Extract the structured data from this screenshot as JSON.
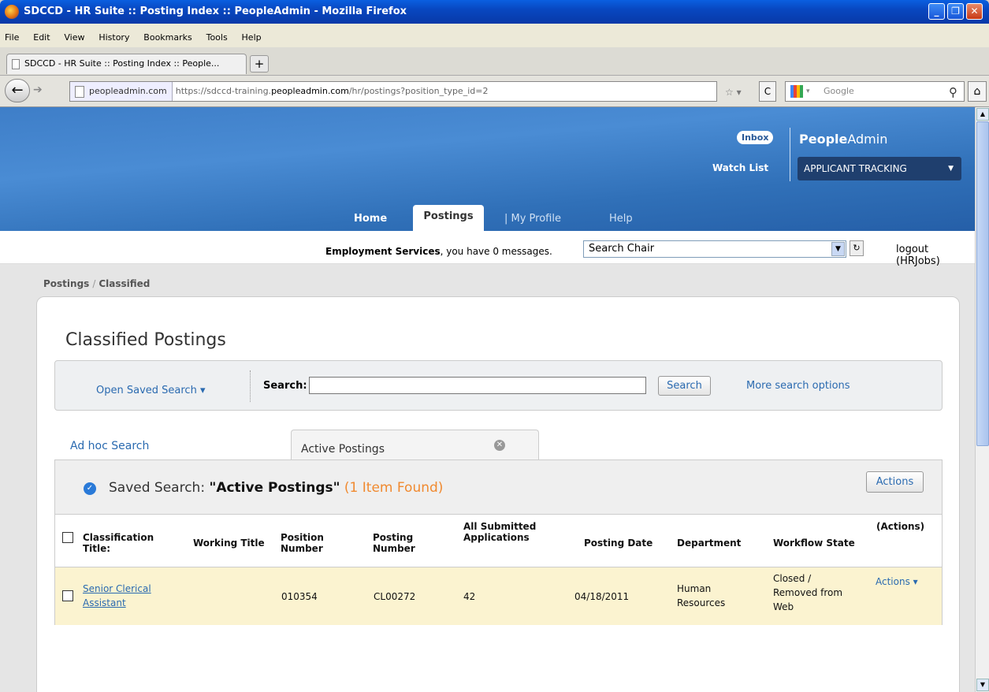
{
  "window": {
    "title": "SDCCD - HR Suite :: Posting Index :: PeopleAdmin - Mozilla Firefox"
  },
  "menu": [
    "File",
    "Edit",
    "View",
    "History",
    "Bookmarks",
    "Tools",
    "Help"
  ],
  "tab": {
    "title": "SDCCD - HR Suite :: Posting Index :: People...",
    "new_tab": "+"
  },
  "address": {
    "site": "peopleadmin.com",
    "url_prefix": "https://sdccd-training.",
    "url_domain": "peopleadmin.com",
    "url_suffix": "/hr/postings?position_type_id=2"
  },
  "search_engine": {
    "placeholder": "Google"
  },
  "header": {
    "inbox": "Inbox",
    "watch_list": "Watch List",
    "brand_bold": "People",
    "brand_rest": "Admin",
    "module": "APPLICANT TRACKING"
  },
  "nav": {
    "home": "Home",
    "postings": "Postings",
    "my_profile": "| My Profile",
    "help": "Help"
  },
  "messages": {
    "user": "Employment Services",
    "text": ", you have 0 messages.",
    "chair_select": "Search Chair",
    "logout": "logout (HRJobs)"
  },
  "breadcrumb": {
    "root": "Postings",
    "sep": "/",
    "current": "Classified"
  },
  "page_title": "Classified Postings",
  "search": {
    "open_saved": "Open Saved Search ▾",
    "label": "Search:",
    "button": "Search",
    "more": "More search options"
  },
  "tabs": {
    "adhoc": "Ad hoc Search",
    "active": "Active Postings"
  },
  "results": {
    "prefix": "Saved Search: ",
    "name": "\"Active Postings\"",
    "found": " (1 Item Found)",
    "actions": "Actions"
  },
  "columns": {
    "classification": "Classification Title:",
    "working": "Working Title",
    "position": "Position Number",
    "posting": "Posting Number",
    "applications": "All Submitted Applications",
    "date": "Posting Date",
    "department": "Department",
    "workflow": "Workflow State",
    "actions": "(Actions)"
  },
  "rows": [
    {
      "classification": "Senior Clerical Assistant",
      "working": "",
      "position": "010354",
      "posting": "CL00272",
      "applications": "42",
      "date": "04/18/2011",
      "department": "Human Resources",
      "workflow": "Closed / Removed from Web",
      "actions": "Actions ▾"
    }
  ]
}
